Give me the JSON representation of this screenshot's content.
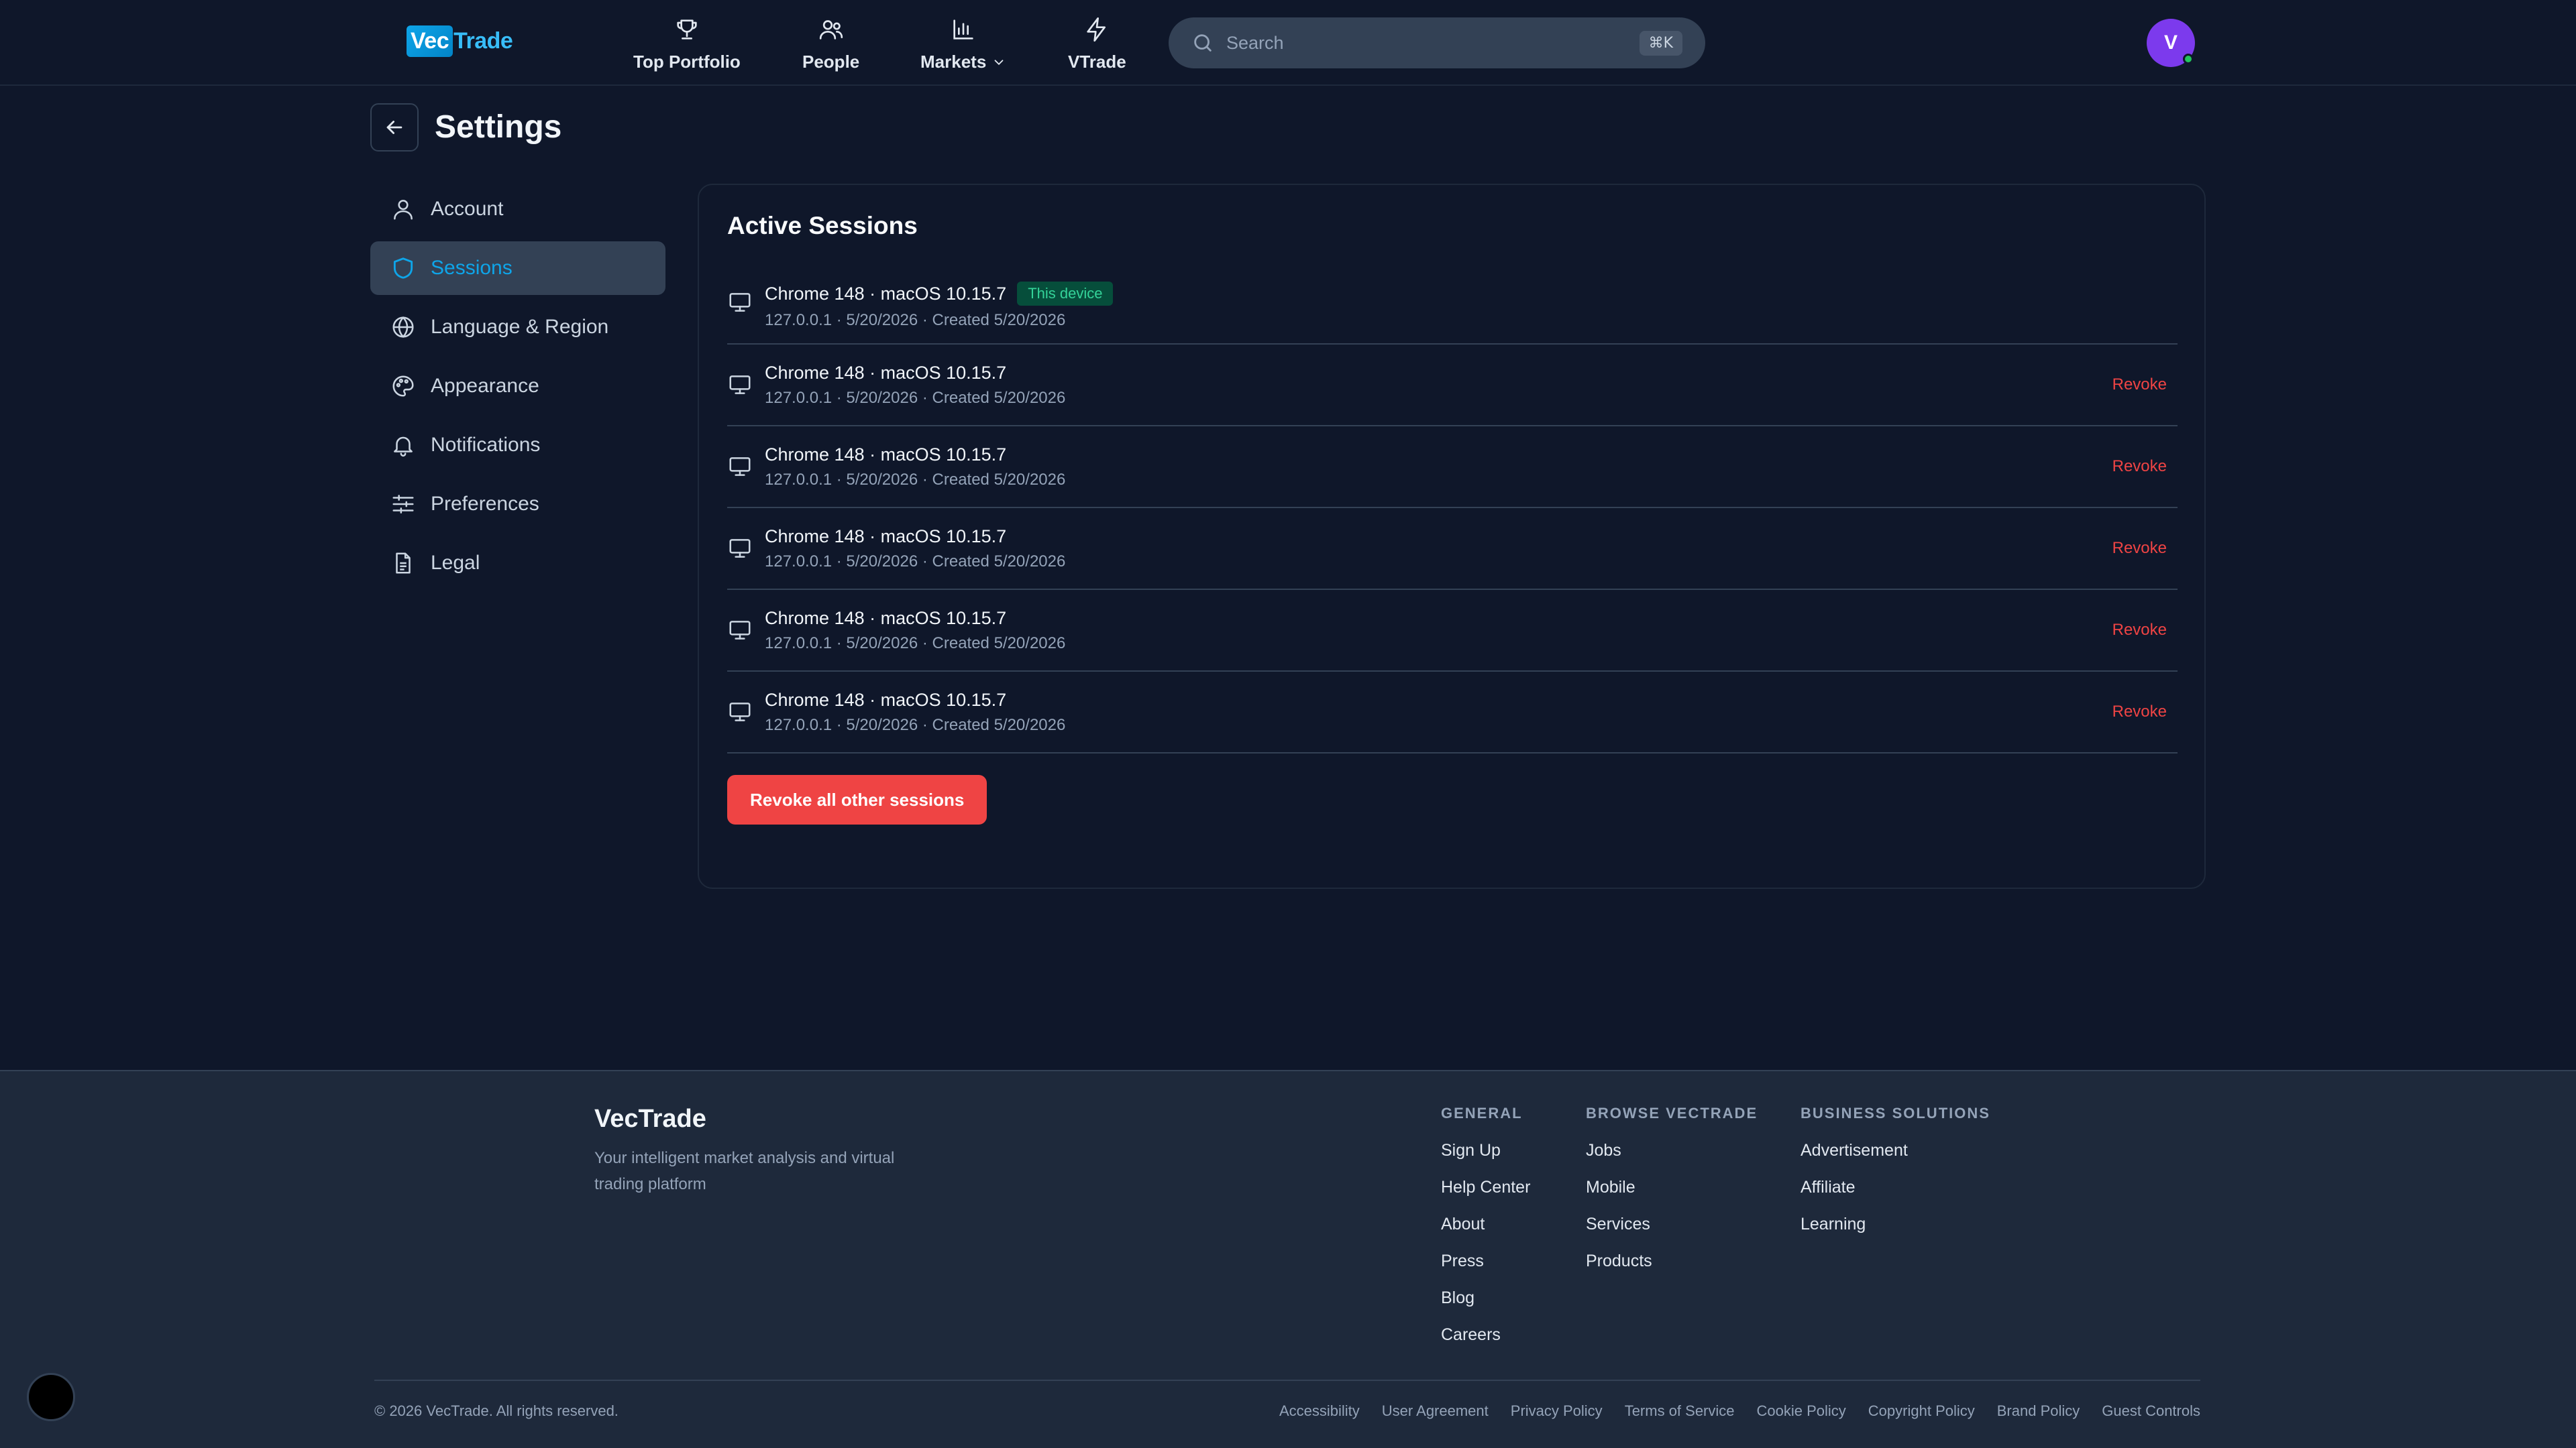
{
  "brand": {
    "logo_part1": "Vec",
    "logo_part2": "Trade"
  },
  "nav": {
    "items": [
      {
        "label": "Top Portfolio",
        "icon": "trophy-icon"
      },
      {
        "label": "People",
        "icon": "users-icon"
      },
      {
        "label": "Markets",
        "icon": "bar-chart-icon",
        "has_dropdown": true
      },
      {
        "label": "VTrade",
        "icon": "lightning-icon"
      }
    ],
    "search_placeholder": "Search",
    "search_shortcut": "⌘K",
    "avatar_initial": "V"
  },
  "page": {
    "title": "Settings"
  },
  "sidebar": {
    "items": [
      {
        "label": "Account",
        "icon": "user-icon"
      },
      {
        "label": "Sessions",
        "icon": "shield-icon",
        "active": true
      },
      {
        "label": "Language & Region",
        "icon": "globe-icon"
      },
      {
        "label": "Appearance",
        "icon": "palette-icon"
      },
      {
        "label": "Notifications",
        "icon": "bell-icon"
      },
      {
        "label": "Preferences",
        "icon": "sliders-icon"
      },
      {
        "label": "Legal",
        "icon": "document-icon"
      }
    ]
  },
  "sessions": {
    "title": "Active Sessions",
    "this_device_badge": "This device",
    "revoke_label": "Revoke",
    "revoke_all_label": "Revoke all other sessions",
    "items": [
      {
        "name": "Chrome 148 · macOS 10.15.7",
        "meta": "127.0.0.1 · 5/20/2026 · Created 5/20/2026",
        "current": true
      },
      {
        "name": "Chrome 148 · macOS 10.15.7",
        "meta": "127.0.0.1 · 5/20/2026 · Created 5/20/2026"
      },
      {
        "name": "Chrome 148 · macOS 10.15.7",
        "meta": "127.0.0.1 · 5/20/2026 · Created 5/20/2026"
      },
      {
        "name": "Chrome 148 · macOS 10.15.7",
        "meta": "127.0.0.1 · 5/20/2026 · Created 5/20/2026"
      },
      {
        "name": "Chrome 148 · macOS 10.15.7",
        "meta": "127.0.0.1 · 5/20/2026 · Created 5/20/2026"
      },
      {
        "name": "Chrome 148 · macOS 10.15.7",
        "meta": "127.0.0.1 · 5/20/2026 · Created 5/20/2026"
      }
    ]
  },
  "footer": {
    "brand": "VecTrade",
    "tagline": "Your intelligent market analysis and virtual trading platform",
    "columns": [
      {
        "heading": "GENERAL",
        "links": [
          "Sign Up",
          "Help Center",
          "About",
          "Press",
          "Blog",
          "Careers"
        ]
      },
      {
        "heading": "BROWSE VECTRADE",
        "links": [
          "Jobs",
          "Mobile",
          "Services",
          "Products"
        ]
      },
      {
        "heading": "BUSINESS SOLUTIONS",
        "links": [
          "Advertisement",
          "Affiliate",
          "Learning"
        ]
      }
    ],
    "copyright": "© 2026 VecTrade. All rights reserved.",
    "legal_links": [
      "Accessibility",
      "User Agreement",
      "Privacy Policy",
      "Terms of Service",
      "Cookie Policy",
      "Copyright Policy",
      "Brand Policy",
      "Guest Controls"
    ]
  },
  "colors": {
    "background": "#0f172a",
    "accent": "#0ea5e9",
    "danger": "#ef4444",
    "success": "#34d399",
    "avatar": "#7c3aed"
  }
}
